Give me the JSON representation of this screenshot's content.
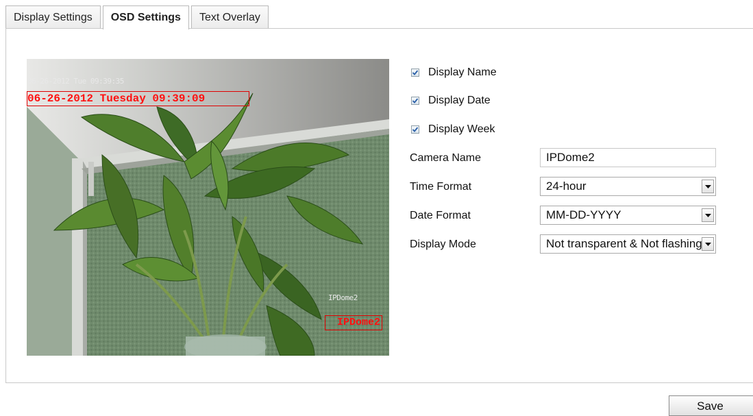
{
  "tabs": [
    {
      "label": "Display Settings",
      "active": false
    },
    {
      "label": "OSD Settings",
      "active": true
    },
    {
      "label": "Text Overlay",
      "active": false
    }
  ],
  "preview": {
    "osd_camera_time": "06-26-2012 Tue 09:39:35",
    "osd_date_region": "06-26-2012 Tuesday 09:39:09",
    "osd_camera_name": "IPDome2",
    "osd_name_region": "IPDome2"
  },
  "checkboxes": [
    {
      "label": "Display Name",
      "checked": true
    },
    {
      "label": "Display Date",
      "checked": true
    },
    {
      "label": "Display Week",
      "checked": true
    }
  ],
  "form": {
    "camera_name": {
      "label": "Camera Name",
      "value": "IPDome2"
    },
    "time_format": {
      "label": "Time Format",
      "value": "24-hour"
    },
    "date_format": {
      "label": "Date Format",
      "value": "MM-DD-YYYY"
    },
    "display_mode": {
      "label": "Display Mode",
      "value": "Not transparent & Not flashing"
    }
  },
  "actions": {
    "save_label": "Save"
  },
  "colors": {
    "osd_red": "#ff1010",
    "checkbox_tick": "#2a5fa8"
  }
}
